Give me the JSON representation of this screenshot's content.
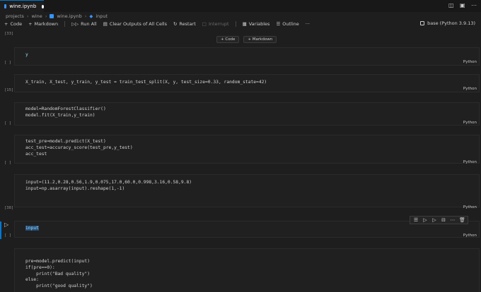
{
  "tab": {
    "label": "wine.ipynb"
  },
  "breadcrumb": {
    "items": [
      "projects",
      "wine",
      "wine.ipynb",
      "input"
    ]
  },
  "toolbar": {
    "code": "Code",
    "markdown": "Markdown",
    "run_all": "Run All",
    "clear_outputs": "Clear Outputs of All Cells",
    "restart": "Restart",
    "interrupt": "Interrupt",
    "variables": "Variables",
    "outline": "Outline",
    "more": "···"
  },
  "kernel": {
    "label": "base (Python 3.9.13)"
  },
  "add_cell": {
    "code": "+ Code",
    "markdown": "+ Markdown"
  },
  "cells": [
    {
      "count": "[33]",
      "lang": "Python",
      "code": "y"
    },
    {
      "count": "[ ]",
      "lang": "Python",
      "code": "X_train, X_test, y_train, y_test = train_test_split(X, y, test_size=0.33, random_state=42)"
    },
    {
      "count": "[15]",
      "lang": "Python",
      "code": "model=RandomForestClassifier()\nmodel.fit(X_train,y_train)"
    },
    {
      "count": "[ ]",
      "lang": "Python",
      "code": "test_pre=model.predict(X_test)\nacc_test=accuracy_score(test_pre,y_test)\nacc_test"
    },
    {
      "count": "[ ]",
      "lang": "Python",
      "code": "input=(11.2,0.28,0.56,1.9,0.075,17.0,60.0,0.998,3.16,0.58,9.8)\ninput=np.asarray(input).reshape(1,-1)"
    },
    {
      "count": "[38]",
      "lang": "Python",
      "code": "input"
    },
    {
      "count": "[ ]",
      "lang": "Python",
      "code": "pre=model.predict(input)\nif(pre==0):\n    print(\"Bad quality\")\nelse:\n    print(\"good quality\")"
    }
  ]
}
